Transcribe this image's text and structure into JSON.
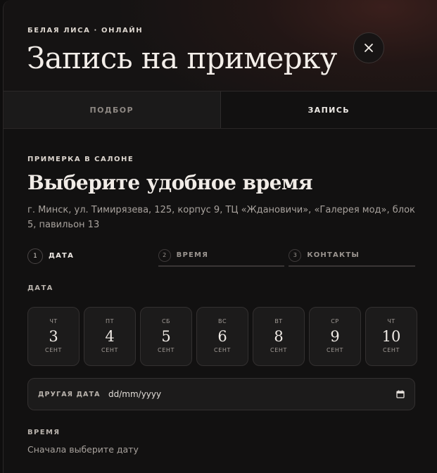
{
  "header": {
    "eyebrow": "БЕЛАЯ ЛИСА · ОНЛАЙН",
    "title": "Запись на примерку",
    "close_icon": "close-icon"
  },
  "tabs": [
    {
      "label": "ПОДБОР",
      "active": false
    },
    {
      "label": "ЗАПИСЬ",
      "active": true
    }
  ],
  "section": {
    "eyebrow": "ПРИМЕРКА В САЛОНЕ",
    "title": "Выберите удобное время",
    "address": "г. Минск, ул. Тимирязева, 125, корпус 9, ТЦ «Ждановичи», «Галерея мод», блок 5, павильон 13"
  },
  "steps": [
    {
      "num": "1",
      "label": "ДАТА",
      "active": true
    },
    {
      "num": "2",
      "label": "ВРЕМЯ",
      "active": false
    },
    {
      "num": "3",
      "label": "КОНТАКТЫ",
      "active": false
    }
  ],
  "date_label": "ДАТА",
  "days": [
    {
      "dow": "ЧТ",
      "num": "3",
      "mon": "СЕНТ"
    },
    {
      "dow": "ПТ",
      "num": "4",
      "mon": "СЕНТ"
    },
    {
      "dow": "СБ",
      "num": "5",
      "mon": "СЕНТ"
    },
    {
      "dow": "ВС",
      "num": "6",
      "mon": "СЕНТ"
    },
    {
      "dow": "ВТ",
      "num": "8",
      "mon": "СЕНТ"
    },
    {
      "dow": "СР",
      "num": "9",
      "mon": "СЕНТ"
    },
    {
      "dow": "ЧТ",
      "num": "10",
      "mon": "СЕНТ"
    }
  ],
  "other_date": {
    "label": "ДРУГАЯ ДАТА",
    "placeholder": "dd/mm/yyyy",
    "icon": "calendar-icon"
  },
  "time_label": "ВРЕМЯ",
  "time_hint": "Сначала выберите дату"
}
